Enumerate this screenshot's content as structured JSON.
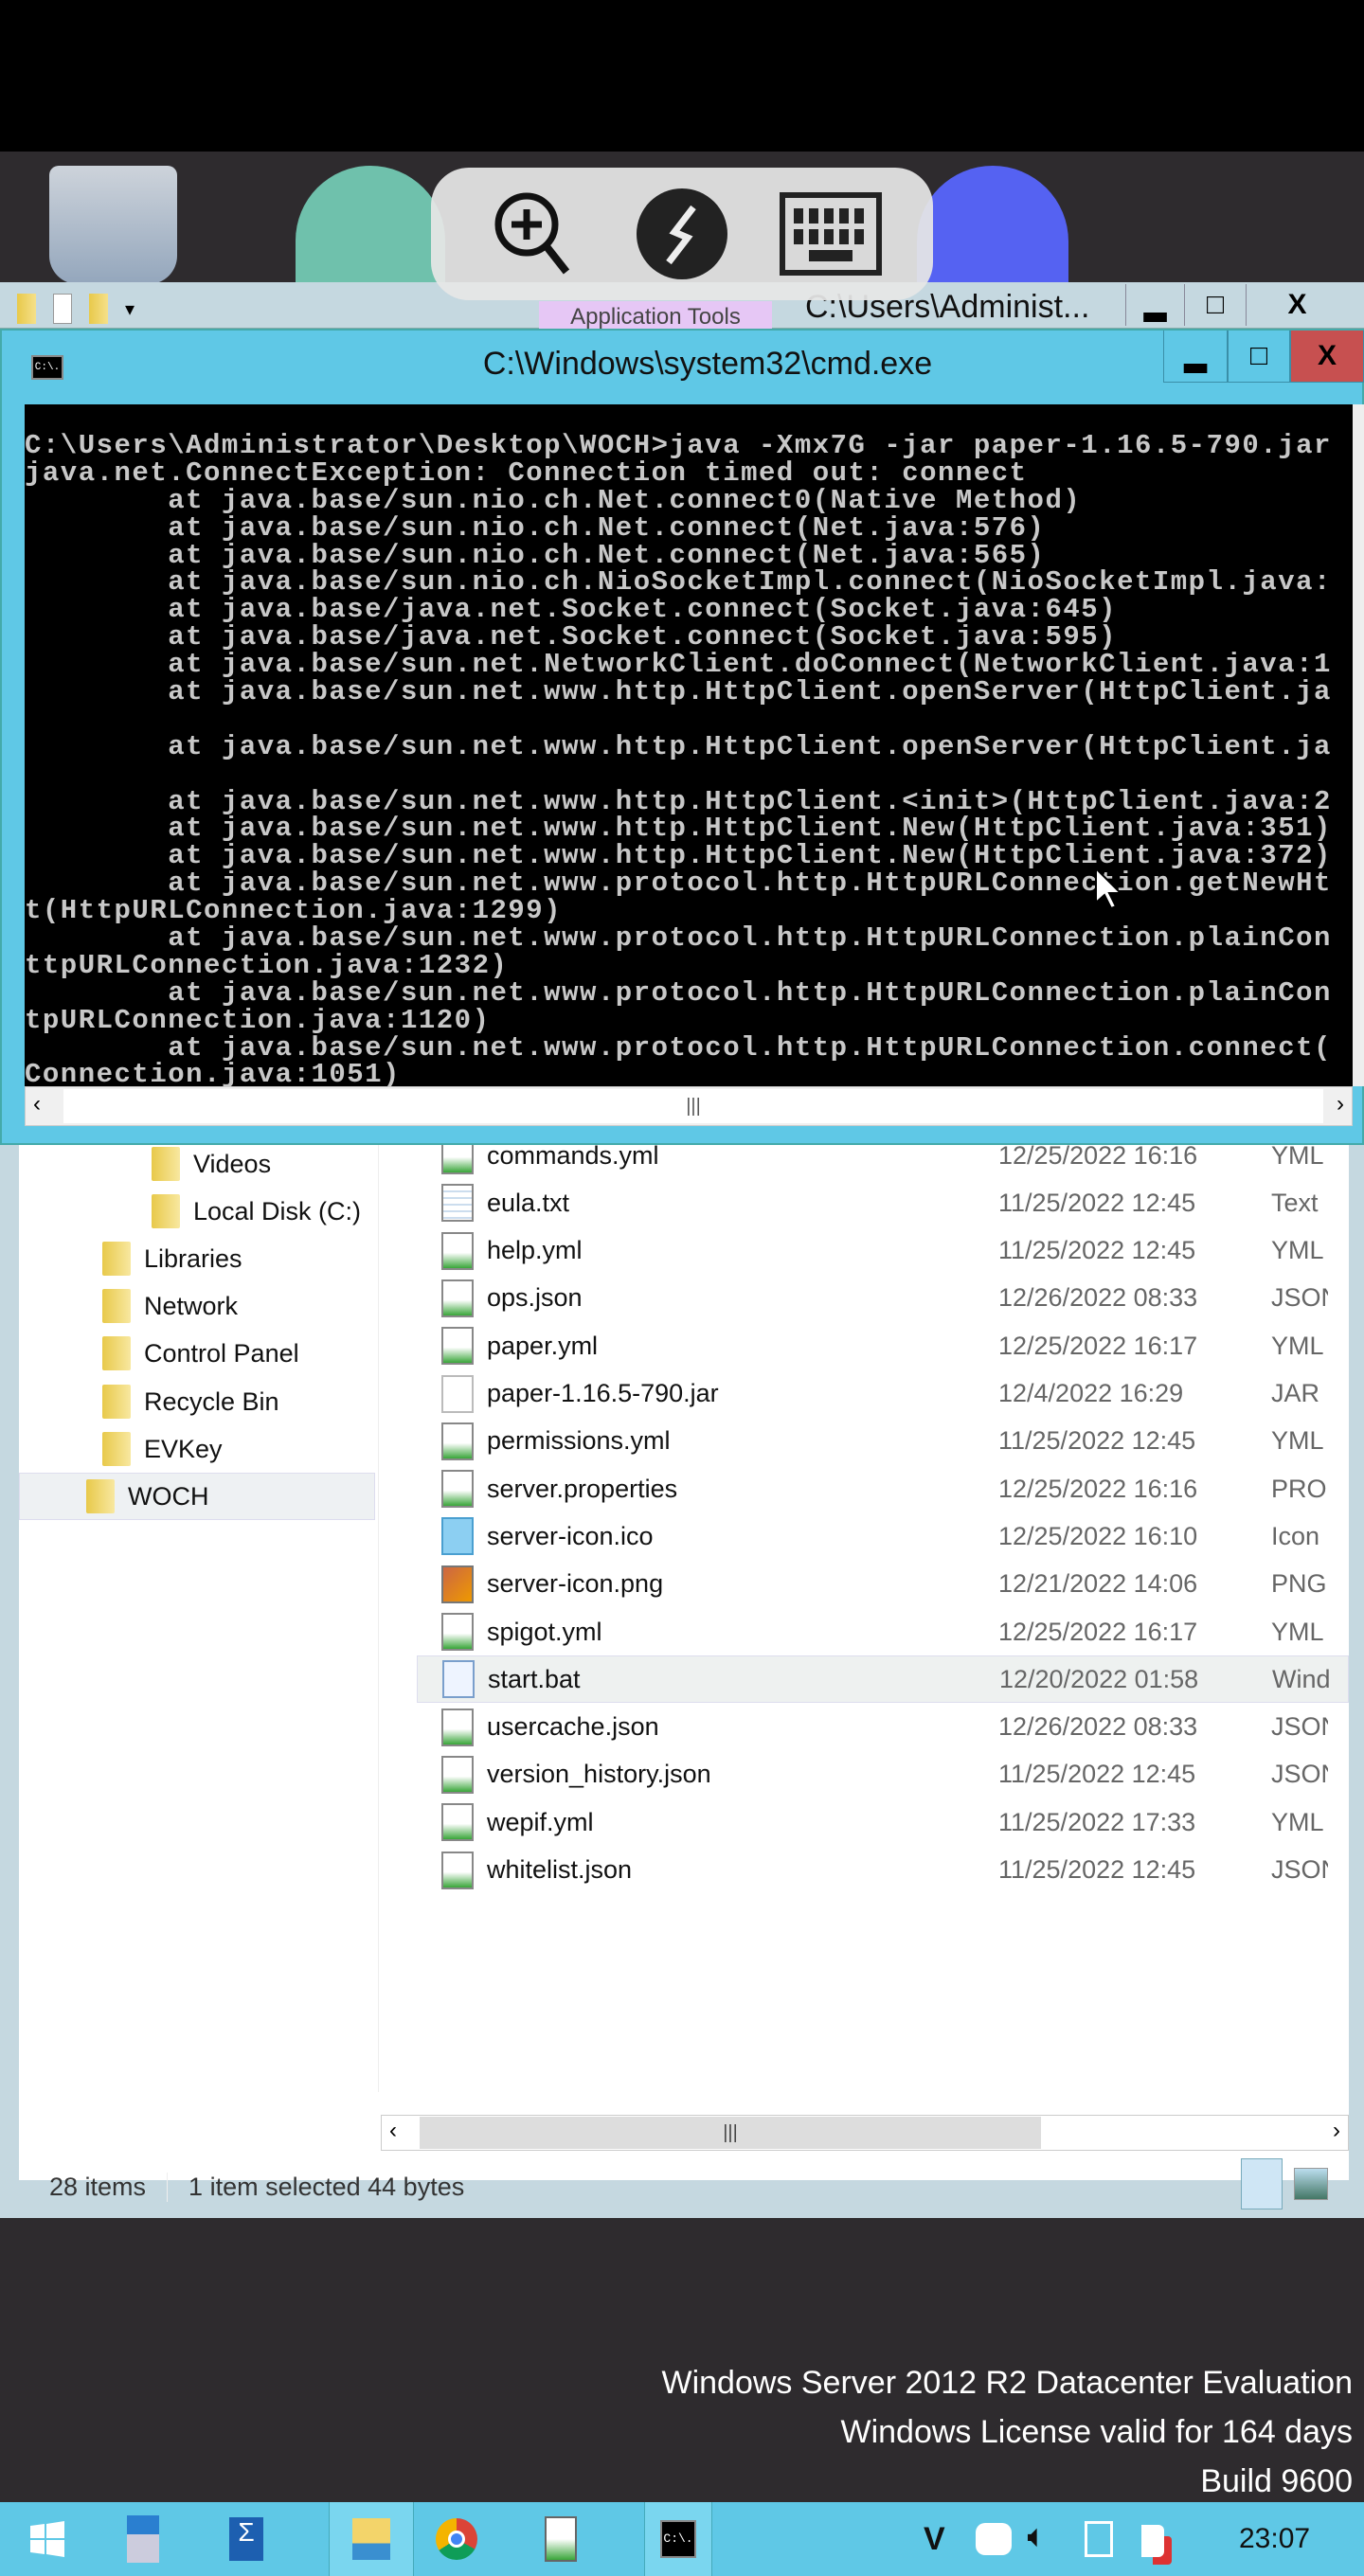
{
  "floating_toolbar": {
    "items": [
      "zoom-in",
      "remote-connection",
      "keyboard"
    ]
  },
  "explorer": {
    "ribbon_tab": "Application Tools",
    "title": "C:\\Users\\Administ...",
    "window_buttons": {
      "minimize": "▂",
      "maximize": "□",
      "close": "X"
    },
    "nav": [
      {
        "label": "Videos",
        "icon": "videos-folder-icon"
      },
      {
        "label": "Local Disk (C:)",
        "icon": "drive-icon"
      },
      {
        "label": "Libraries",
        "icon": "libraries-icon"
      },
      {
        "label": "Network",
        "icon": "network-icon"
      },
      {
        "label": "Control Panel",
        "icon": "control-panel-icon"
      },
      {
        "label": "Recycle Bin",
        "icon": "recycle-bin-icon"
      },
      {
        "label": "EVKey",
        "icon": "folder-icon"
      },
      {
        "label": "WOCH",
        "icon": "folder-icon",
        "selected": true
      }
    ],
    "files": [
      {
        "name": "commands.yml",
        "date": "12/25/2022 16:16",
        "type": "YML",
        "icon": "yml"
      },
      {
        "name": "eula.txt",
        "date": "11/25/2022 12:45",
        "type": "Text",
        "icon": "txt"
      },
      {
        "name": "help.yml",
        "date": "11/25/2022 12:45",
        "type": "YML",
        "icon": "yml"
      },
      {
        "name": "ops.json",
        "date": "12/26/2022 08:33",
        "type": "JSON",
        "icon": "yml"
      },
      {
        "name": "paper.yml",
        "date": "12/25/2022 16:17",
        "type": "YML",
        "icon": "yml"
      },
      {
        "name": "paper-1.16.5-790.jar",
        "date": "12/4/2022 16:29",
        "type": "JAR F",
        "icon": "jar"
      },
      {
        "name": "permissions.yml",
        "date": "11/25/2022 12:45",
        "type": "YML",
        "icon": "yml"
      },
      {
        "name": "server.properties",
        "date": "12/25/2022 16:16",
        "type": "PROP",
        "icon": "yml"
      },
      {
        "name": "server-icon.ico",
        "date": "12/25/2022 16:10",
        "type": "Icon",
        "icon": "ico"
      },
      {
        "name": "server-icon.png",
        "date": "12/21/2022 14:06",
        "type": "PNG",
        "icon": "png"
      },
      {
        "name": "spigot.yml",
        "date": "12/25/2022 16:17",
        "type": "YML",
        "icon": "yml"
      },
      {
        "name": "start.bat",
        "date": "12/20/2022 01:58",
        "type": "Wind",
        "icon": "bat",
        "selected": true
      },
      {
        "name": "usercache.json",
        "date": "12/26/2022 08:33",
        "type": "JSON",
        "icon": "yml"
      },
      {
        "name": "version_history.json",
        "date": "11/25/2022 12:45",
        "type": "JSON",
        "icon": "yml"
      },
      {
        "name": "wepif.yml",
        "date": "11/25/2022 17:33",
        "type": "YML",
        "icon": "yml"
      },
      {
        "name": "whitelist.json",
        "date": "11/25/2022 12:45",
        "type": "JSON",
        "icon": "yml"
      }
    ],
    "status": {
      "count": "28 items",
      "selection": "1 item selected  44 bytes"
    },
    "scroll_grip": "|||"
  },
  "cmd": {
    "title": "C:\\Windows\\system32\\cmd.exe",
    "icon_text": "C:\\.",
    "window_buttons": {
      "minimize": "▂",
      "maximize": "□",
      "close": "X"
    },
    "lines": [
      "C:\\Users\\Administrator\\Desktop\\WOCH>java -Xmx7G -jar paper-1.16.5-790.jar",
      "java.net.ConnectException: Connection timed out: connect",
      "        at java.base/sun.nio.ch.Net.connect0(Native Method)",
      "        at java.base/sun.nio.ch.Net.connect(Net.java:576)",
      "        at java.base/sun.nio.ch.Net.connect(Net.java:565)",
      "        at java.base/sun.nio.ch.NioSocketImpl.connect(NioSocketImpl.java:",
      "        at java.base/java.net.Socket.connect(Socket.java:645)",
      "        at java.base/java.net.Socket.connect(Socket.java:595)",
      "        at java.base/sun.net.NetworkClient.doConnect(NetworkClient.java:1",
      "        at java.base/sun.net.www.http.HttpClient.openServer(HttpClient.ja",
      "",
      "        at java.base/sun.net.www.http.HttpClient.openServer(HttpClient.ja",
      "",
      "        at java.base/sun.net.www.http.HttpClient.<init>(HttpClient.java:2",
      "        at java.base/sun.net.www.http.HttpClient.New(HttpClient.java:351)",
      "        at java.base/sun.net.www.http.HttpClient.New(HttpClient.java:372)",
      "        at java.base/sun.net.www.protocol.http.HttpURLConnection.getNewHt",
      "t(HttpURLConnection.java:1299)",
      "        at java.base/sun.net.www.protocol.http.HttpURLConnection.plainCon",
      "ttpURLConnection.java:1232)",
      "        at java.base/sun.net.www.protocol.http.HttpURLConnection.plainCon",
      "tpURLConnection.java:1120)",
      "        at java.base/sun.net.www.protocol.http.HttpURLConnection.connect(",
      "Connection.java:1051)"
    ],
    "scroll_grip": "|||"
  },
  "watermark": [
    "Windows Server 2012 R2 Datacenter Evaluation",
    "Windows License valid for 164 days",
    "Build 9600"
  ],
  "taskbar": {
    "apps": [
      "start",
      "server-manager",
      "powershell",
      "file-explorer",
      "chrome",
      "notepad",
      "cmd"
    ],
    "tray": {
      "v_label": "V"
    },
    "clock": "23:07"
  },
  "colors": {
    "taskbar": "#5fc8e6",
    "cmd_close": "#c75050",
    "app_tools": "#e6c7f5"
  }
}
